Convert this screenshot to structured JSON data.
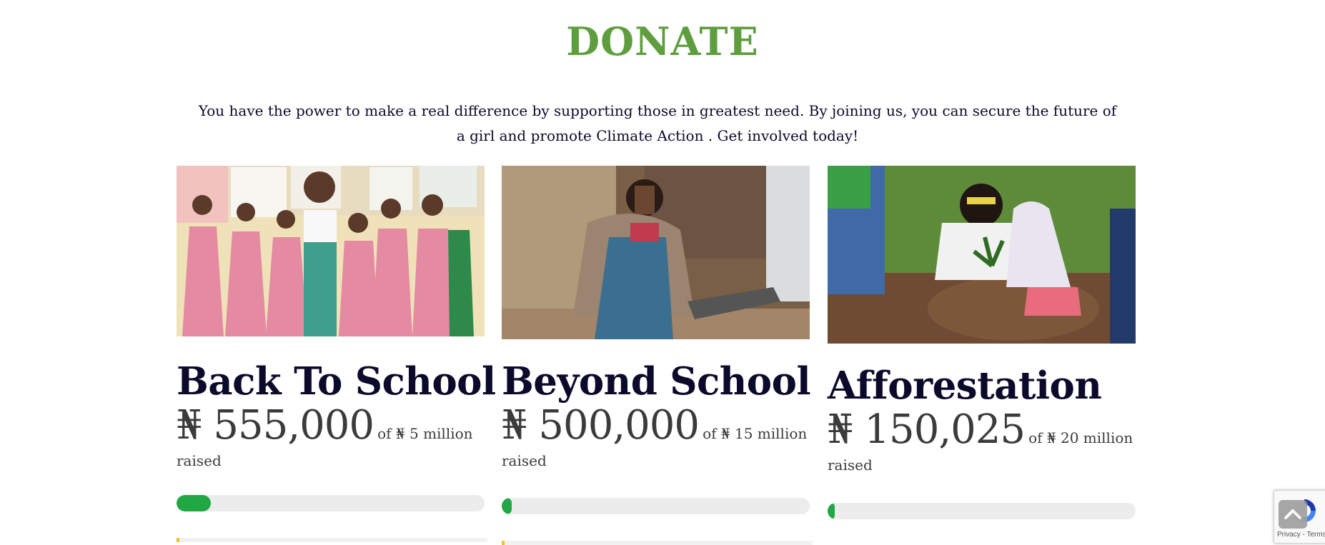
{
  "page": {
    "title": "DONATE",
    "intro": "You have the power to make a real difference by supporting those in greatest need. By joining us, you can secure the future of a girl and promote Climate Action . Get involved today!"
  },
  "campaigns": [
    {
      "title": "Back To School",
      "amount": "₦ 555,000",
      "goal": "of ₦ 5 million",
      "raised_label": "raised",
      "progress": 0.111,
      "image": "photo-girls-in-pink-uniforms"
    },
    {
      "title": "Beyond School",
      "amount": "₦ 500,000",
      "goal": "of ₦ 15 million",
      "raised_label": "raised",
      "progress": 0.033,
      "image": "photo-girl-woodworking"
    },
    {
      "title": "Afforestation",
      "amount": "₦ 150,025",
      "goal": "of ₦ 20 million",
      "raised_label": "raised",
      "progress": 0.0075,
      "image": "photo-tree-planting"
    }
  ],
  "widgets": {
    "recaptcha_text": "Privacy - Terms",
    "scroll_top_icon": "chevron-up-icon"
  },
  "colors": {
    "title": "#5f9e3f",
    "text": "#0b0a2b",
    "progress": "#22a745",
    "track": "#ececec"
  }
}
